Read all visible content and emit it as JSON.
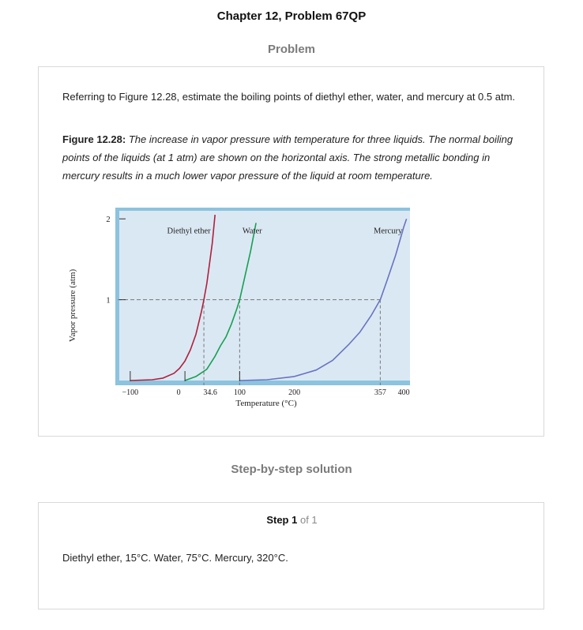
{
  "header": {
    "title": "Chapter 12, Problem 67QP"
  },
  "problem": {
    "heading": "Problem",
    "text": "Referring to Figure 12.28, estimate the boiling points of diethyl ether, water, and mercury at 0.5 atm.",
    "caption_label": "Figure 12.28:",
    "caption_text": " The increase in vapor pressure with temperature for three liquids. The normal boiling points of the liquids (at 1 atm) are shown on the horizontal axis. The strong metallic bonding in mercury results in a much lower vapor pressure of the liquid at room temperature."
  },
  "chart_data": {
    "type": "line",
    "title": "",
    "xlabel": "Temperature (°C)",
    "ylabel": "Vapor pressure (atm)",
    "xlim": [
      -120,
      420
    ],
    "ylim": [
      0,
      2.1
    ],
    "x_ticks": [
      -100,
      0,
      34.6,
      100,
      200,
      357,
      400
    ],
    "x_tick_labels": [
      "−100",
      "0",
      "34.6",
      "100",
      "200",
      "357",
      "400"
    ],
    "y_ticks": [
      1,
      2
    ],
    "y_tick_labels": [
      "1",
      "2"
    ],
    "reference_line_y": 1,
    "grid": false,
    "colors": {
      "plot_bg": "#dae8f4",
      "frame": "#8cc3df",
      "reference": "#777777"
    },
    "series": [
      {
        "name": "Diethyl ether",
        "color": "#b0203a",
        "boiling_point": 34.6,
        "points": [
          [
            -100,
            0.0
          ],
          [
            -60,
            0.01
          ],
          [
            -40,
            0.03
          ],
          [
            -20,
            0.09
          ],
          [
            -10,
            0.15
          ],
          [
            0,
            0.24
          ],
          [
            10,
            0.38
          ],
          [
            20,
            0.57
          ],
          [
            30,
            0.85
          ],
          [
            34.6,
            1.0
          ],
          [
            40,
            1.2
          ],
          [
            45,
            1.45
          ],
          [
            50,
            1.7
          ],
          [
            55,
            2.05
          ]
        ]
      },
      {
        "name": "Water",
        "color": "#17a050",
        "boiling_point": 100,
        "points": [
          [
            0,
            0.0
          ],
          [
            20,
            0.05
          ],
          [
            40,
            0.14
          ],
          [
            55,
            0.3
          ],
          [
            65,
            0.43
          ],
          [
            75,
            0.54
          ],
          [
            85,
            0.7
          ],
          [
            95,
            0.89
          ],
          [
            100,
            1.0
          ],
          [
            110,
            1.3
          ],
          [
            120,
            1.6
          ],
          [
            130,
            1.95
          ]
        ]
      },
      {
        "name": "Mercury",
        "color": "#6a72c0",
        "boiling_point": 357,
        "points": [
          [
            100,
            0.0
          ],
          [
            150,
            0.01
          ],
          [
            200,
            0.05
          ],
          [
            240,
            0.13
          ],
          [
            270,
            0.25
          ],
          [
            300,
            0.45
          ],
          [
            320,
            0.6
          ],
          [
            340,
            0.8
          ],
          [
            357,
            1.0
          ],
          [
            370,
            1.25
          ],
          [
            385,
            1.55
          ],
          [
            400,
            1.9
          ],
          [
            405,
            2.0
          ]
        ]
      }
    ]
  },
  "solution": {
    "heading": "Step-by-step solution",
    "step_label": "Step 1",
    "step_of": "of 1",
    "answer": "Diethyl ether, 15°C. Water, 75°C. Mercury, 320°C."
  }
}
